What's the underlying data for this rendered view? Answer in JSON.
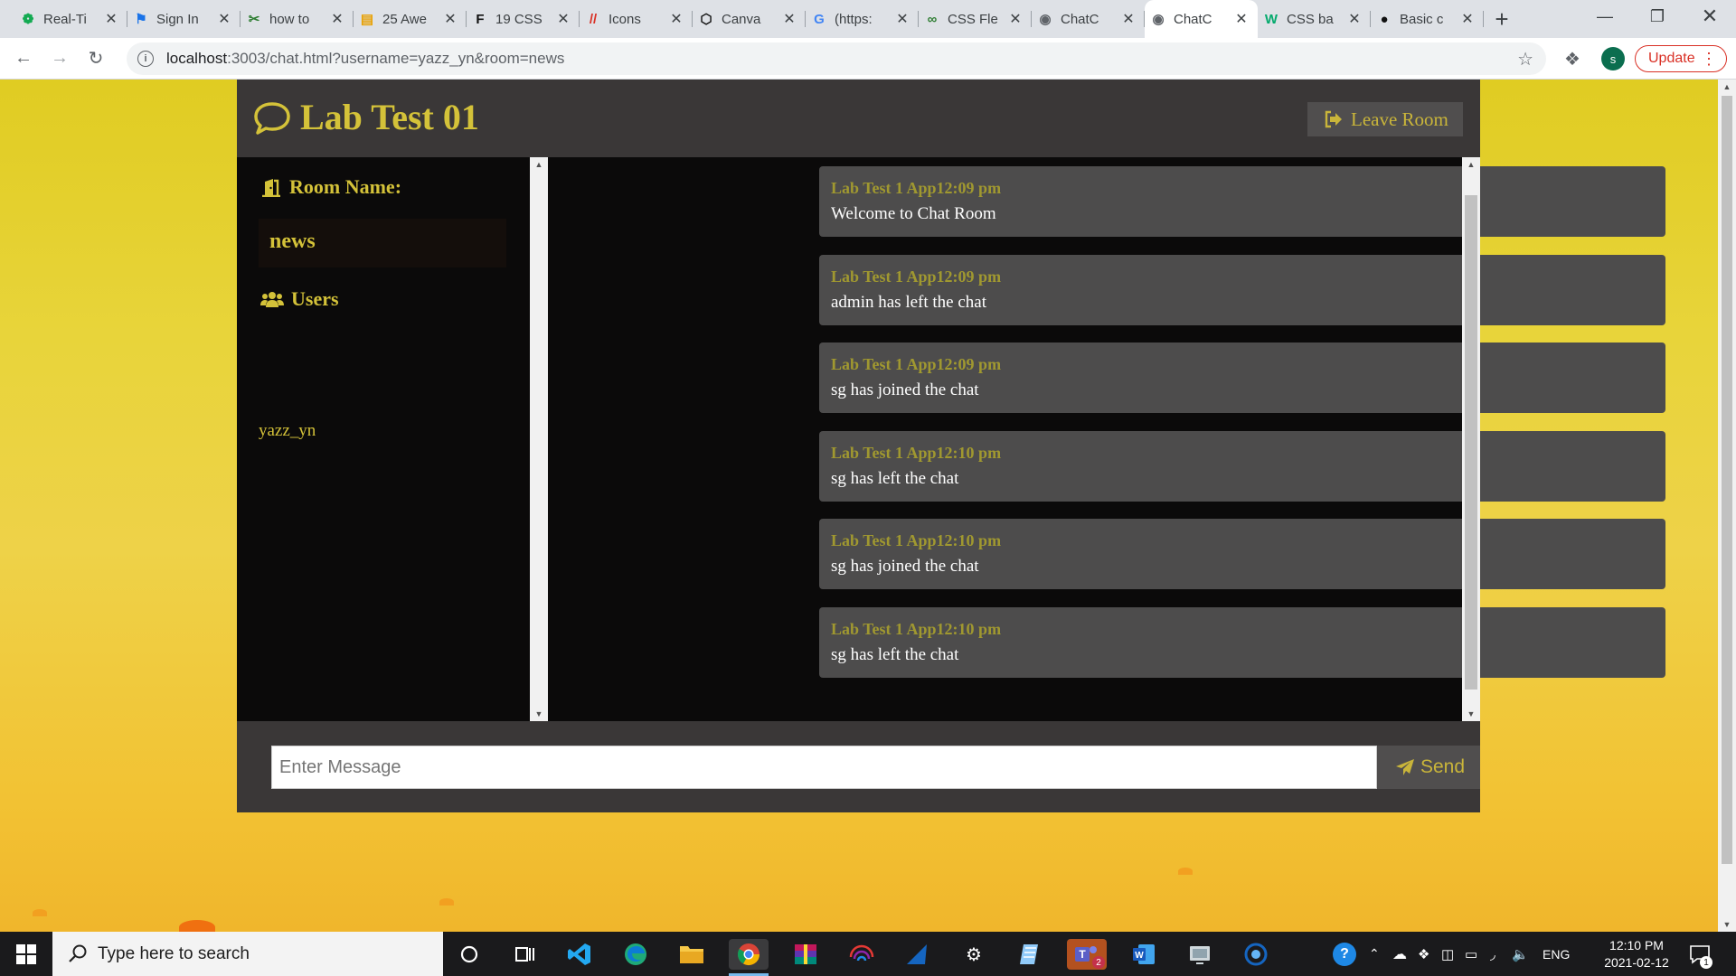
{
  "browser": {
    "tabs": [
      {
        "title": "Real-Ti",
        "icon": "mongodb-leaf-icon",
        "color": "#13aa52"
      },
      {
        "title": "Sign In",
        "icon": "flag-icon",
        "color": "#1a73e8"
      },
      {
        "title": "how to",
        "icon": "scissors-icon",
        "color": "#2e7d32"
      },
      {
        "title": "25 Awe",
        "icon": "chart-icon",
        "color": "#e8a000"
      },
      {
        "title": "19 CSS",
        "icon": "f-logo-icon",
        "color": "#111111"
      },
      {
        "title": "Icons",
        "icon": "iconify-icon",
        "color": "#d93025"
      },
      {
        "title": "Canva",
        "icon": "codepen-icon",
        "color": "#111111"
      },
      {
        "title": "(https:",
        "icon": "google-icon",
        "color": "#4285f4"
      },
      {
        "title": "CSS Fle",
        "icon": "link-icon",
        "color": "#2e7d32"
      },
      {
        "title": "ChatC",
        "icon": "globe-icon",
        "color": "#5f6368"
      },
      {
        "title": "ChatC",
        "icon": "globe-icon",
        "color": "#5f6368",
        "active": true
      },
      {
        "title": "CSS ba",
        "icon": "w3-icon",
        "color": "#04aa6d"
      },
      {
        "title": "Basic c",
        "icon": "github-icon",
        "color": "#111111"
      }
    ],
    "url_host": "localhost",
    "url_rest": ":3003/chat.html?username=yazz_yn&room=news",
    "update_label": "Update",
    "profile_initial": "s"
  },
  "app": {
    "title": "Lab Test 01",
    "leave_label": "Leave Room",
    "room_heading": "Room Name:",
    "room_name": "news",
    "users_heading": "Users",
    "users": [
      "yazz_yn"
    ],
    "messages": [
      {
        "meta": "Lab Test 1 App12:09 pm",
        "text": "Welcome to Chat Room"
      },
      {
        "meta": "Lab Test 1 App12:09 pm",
        "text": "admin has left the chat"
      },
      {
        "meta": "Lab Test 1 App12:09 pm",
        "text": "sg has joined the chat"
      },
      {
        "meta": "Lab Test 1 App12:10 pm",
        "text": "sg has left the chat"
      },
      {
        "meta": "Lab Test 1 App12:10 pm",
        "text": "sg has joined the chat"
      },
      {
        "meta": "Lab Test 1 App12:10 pm",
        "text": "sg has left the chat"
      }
    ],
    "input_placeholder": "Enter Message",
    "send_label": "Send",
    "accent_color": "#d4c239"
  },
  "taskbar": {
    "search_placeholder": "Type here to search",
    "language": "ENG",
    "time": "12:10 PM",
    "date": "2021-02-12",
    "notification_count": "1",
    "teams_badge": "2"
  }
}
